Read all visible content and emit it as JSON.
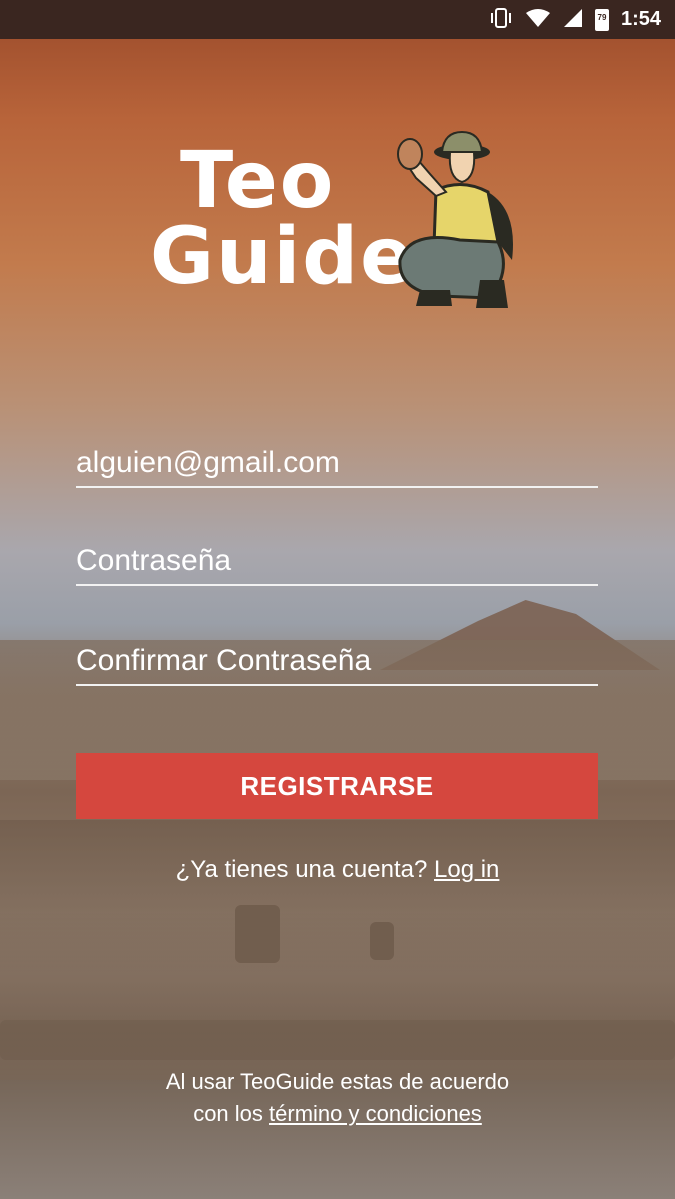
{
  "status_bar": {
    "time": "1:54",
    "battery_level": "79",
    "icons": [
      "vibrate-icon",
      "wifi-icon",
      "signal-icon",
      "battery-icon"
    ]
  },
  "logo": {
    "line1": "Teo",
    "line2": "Guide"
  },
  "form": {
    "email_value": "alguien@gmail.com",
    "password_placeholder": "Contraseña",
    "confirm_password_placeholder": "Confirmar Contraseña",
    "register_label": "REGISTRARSE"
  },
  "login_prompt": {
    "text": "¿Ya tienes una cuenta?",
    "link": "Log in"
  },
  "terms": {
    "line1": "Al usar TeoGuide estas de acuerdo",
    "line2_prefix": "con los",
    "link": "término y condiciones"
  },
  "colors": {
    "accent": "#d5473e",
    "status_bar": "#3a2620"
  }
}
